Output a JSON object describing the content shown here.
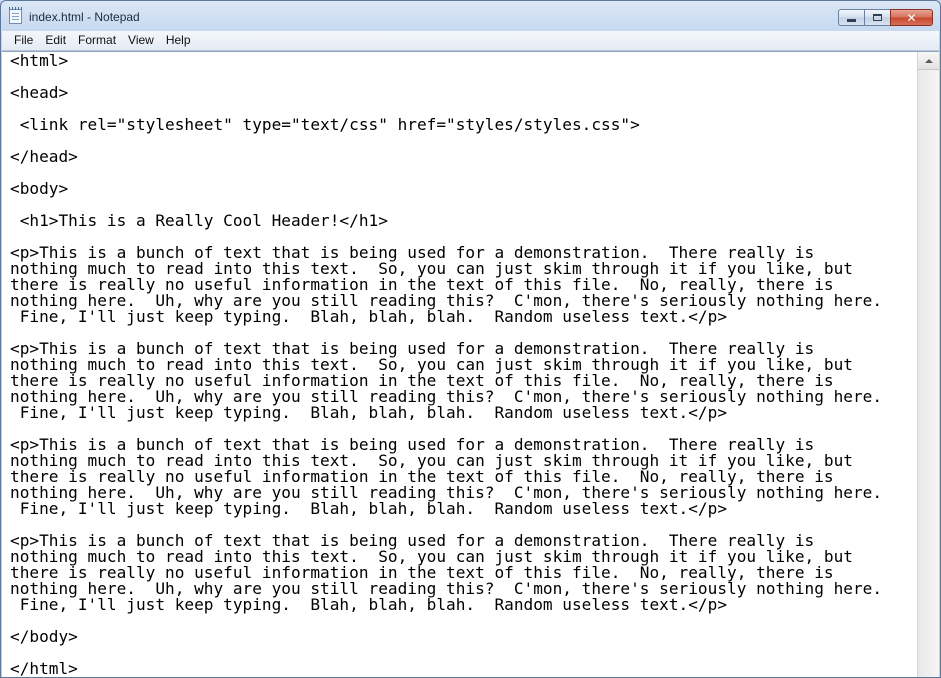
{
  "window": {
    "title": "index.html - Notepad",
    "app_icon": "notepad-icon",
    "buttons": {
      "minimize_icon": "minimize-icon",
      "maximize_icon": "maximize-icon",
      "close_label": "✕"
    }
  },
  "menu": {
    "items": [
      {
        "label": "File"
      },
      {
        "label": "Edit"
      },
      {
        "label": "Format"
      },
      {
        "label": "View"
      },
      {
        "label": "Help"
      }
    ]
  },
  "editor": {
    "content": "<html>\n\n<head>\n\n <link rel=\"stylesheet\" type=\"text/css\" href=\"styles/styles.css\">\n\n</head>\n\n<body>\n\n <h1>This is a Really Cool Header!</h1>\n\n<p>This is a bunch of text that is being used for a demonstration.  There really is\nnothing much to read into this text.  So, you can just skim through it if you like, but\nthere is really no useful information in the text of this file.  No, really, there is\nnothing here.  Uh, why are you still reading this?  C'mon, there's seriously nothing here.\n Fine, I'll just keep typing.  Blah, blah, blah.  Random useless text.</p>\n\n<p>This is a bunch of text that is being used for a demonstration.  There really is\nnothing much to read into this text.  So, you can just skim through it if you like, but\nthere is really no useful information in the text of this file.  No, really, there is\nnothing here.  Uh, why are you still reading this?  C'mon, there's seriously nothing here.\n Fine, I'll just keep typing.  Blah, blah, blah.  Random useless text.</p>\n\n<p>This is a bunch of text that is being used for a demonstration.  There really is\nnothing much to read into this text.  So, you can just skim through it if you like, but\nthere is really no useful information in the text of this file.  No, really, there is\nnothing here.  Uh, why are you still reading this?  C'mon, there's seriously nothing here.\n Fine, I'll just keep typing.  Blah, blah, blah.  Random useless text.</p>\n\n<p>This is a bunch of text that is being used for a demonstration.  There really is\nnothing much to read into this text.  So, you can just skim through it if you like, but\nthere is really no useful information in the text of this file.  No, really, there is\nnothing here.  Uh, why are you still reading this?  C'mon, there's seriously nothing here.\n Fine, I'll just keep typing.  Blah, blah, blah.  Random useless text.</p>\n\n</body>\n\n</html>"
  },
  "scrollbar": {
    "up_icon": "scroll-up-arrow-icon"
  }
}
